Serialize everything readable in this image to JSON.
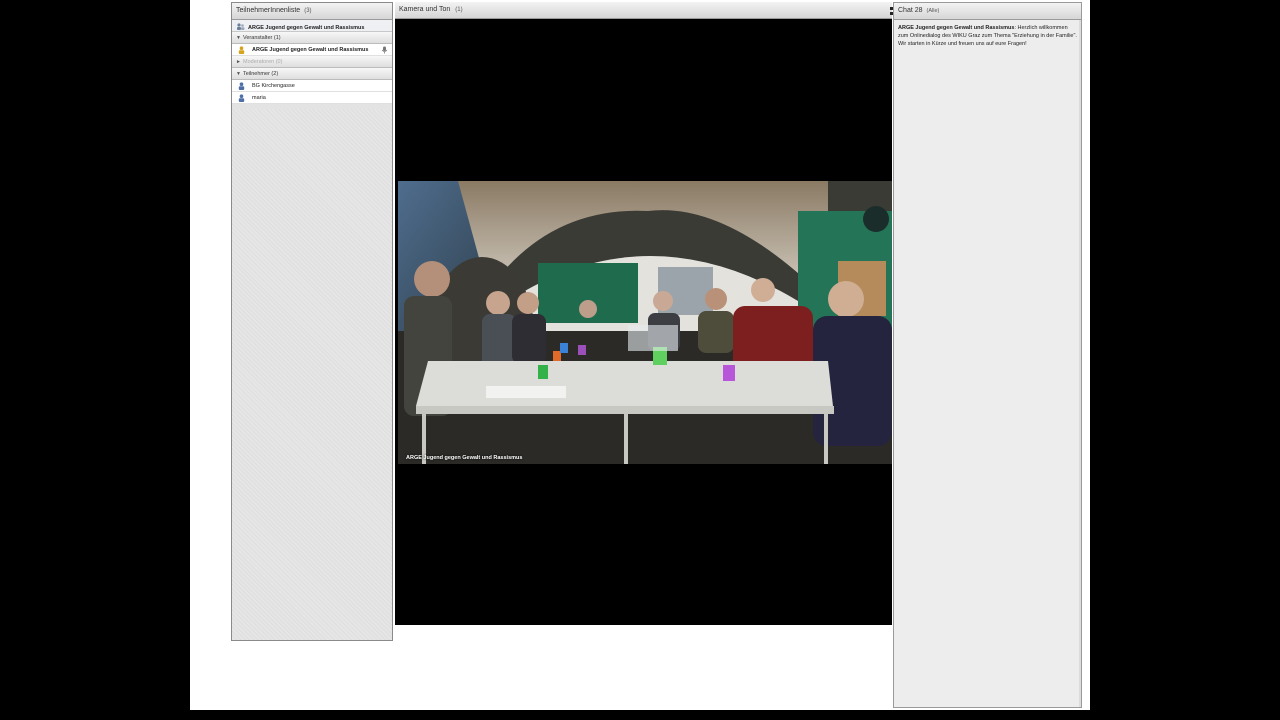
{
  "attendees": {
    "title": "TeilnehmerInnenliste",
    "count": "(3)",
    "host_bar": "ARGE Jugend gegen Gewalt und Rassismus",
    "groups": [
      {
        "label": "Veranstalter (1)",
        "dim": false
      },
      {
        "label": "Moderatoren (0)",
        "dim": true
      },
      {
        "label": "Teilnehmer (2)",
        "dim": false
      }
    ],
    "hosts": [
      {
        "name": "ARGE Jugend gegen Gewalt und Rassismus"
      }
    ],
    "participants": [
      {
        "name": "BG Kirchengasse"
      },
      {
        "name": "maria"
      }
    ]
  },
  "video": {
    "title": "Kamera und Ton",
    "count": "(1)",
    "caption": "ARGE Jugend gegen Gewalt und Rassismus"
  },
  "chat": {
    "title": "Chat 28",
    "scope": "(Alle)",
    "messages": [
      {
        "sender": "ARGE Jugend gegen Gewalt und Rassismus",
        "text": "Herzlich willkommen zum Onlinedialog des WIKU Graz zum Thema \"Erziehung in der Familie\". Wir starten in Kürze und freuen uns auf eure Fragen!"
      }
    ]
  },
  "colors": {
    "background": "#000000",
    "panel": "#e3e3e3",
    "header_top": "#f3f3f3",
    "header_bottom": "#d6d6d6"
  }
}
